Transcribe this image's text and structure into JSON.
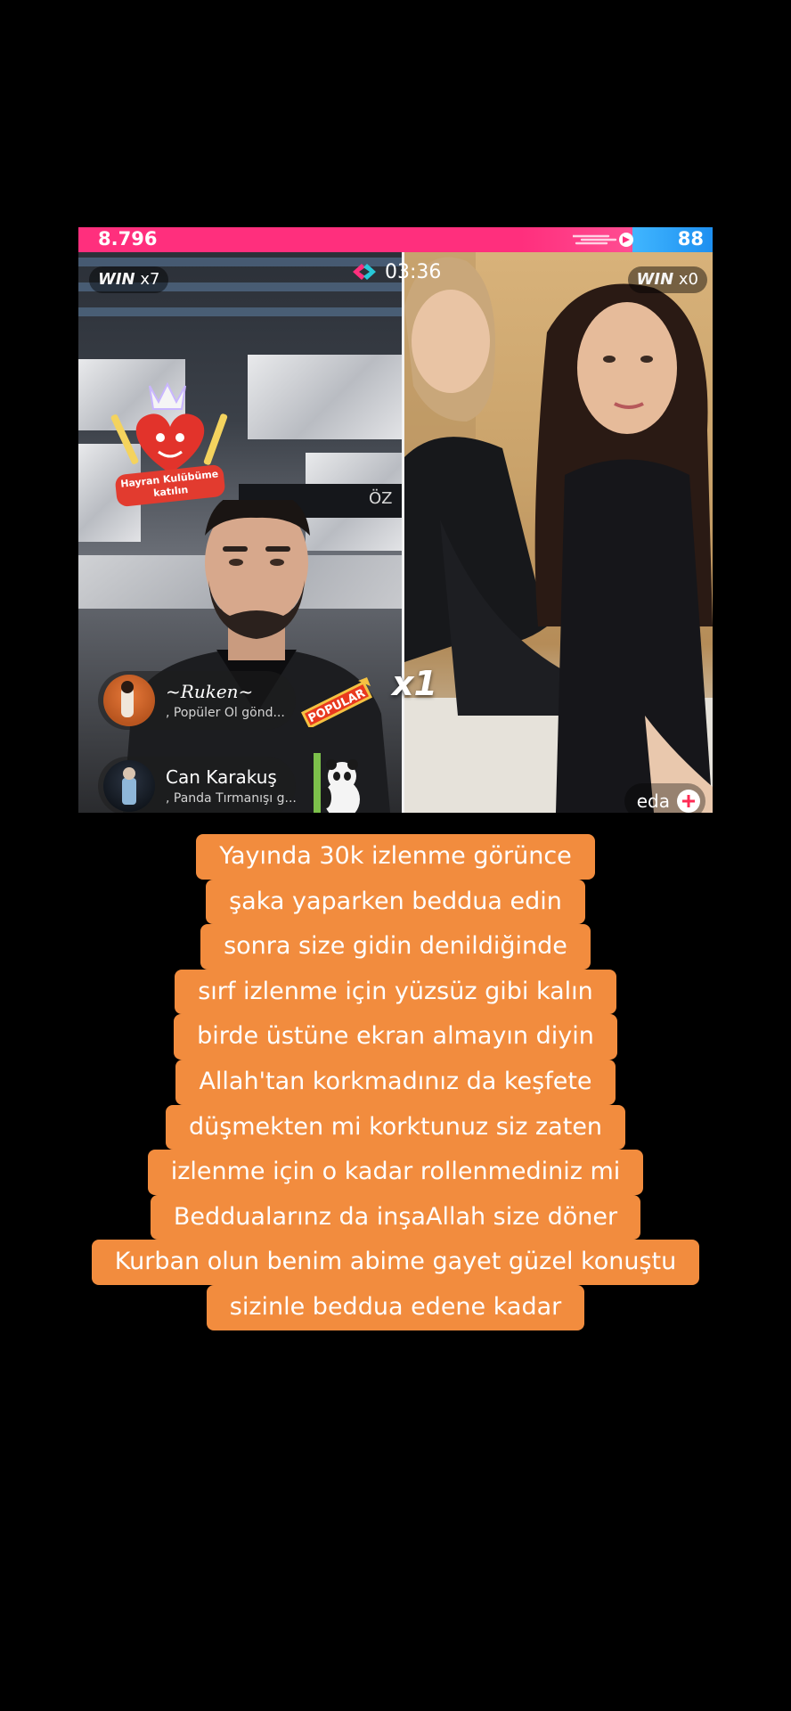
{
  "battle": {
    "score_left": "8.796",
    "score_right": "88",
    "timer": "03:36",
    "win_left": {
      "label": "WIN",
      "count": "x7"
    },
    "win_right": {
      "label": "WIN",
      "count": "x0"
    },
    "fanclub_sticker_text": [
      "Hayran Kulübüme",
      "katılın"
    ],
    "wall_sign_text": "ÖZ",
    "multiplier": "x1",
    "populer_sticker": "POPULAR",
    "viewers": [
      {
        "name": "~Ruken~",
        "subtitle": ", Popüler Ol  gönd..."
      },
      {
        "name": "Can Karakuş",
        "subtitle": ", Panda Tırmanışı g..."
      }
    ],
    "guest_name": "eda",
    "colors": {
      "left_bar": "#ff2f7d",
      "right_bar": "#1e8ff0",
      "caption_bg": "#f28c3e"
    },
    "icons": [
      "battle-icon",
      "crown-icon",
      "heart-icon",
      "add-icon",
      "panda-icon"
    ]
  },
  "caption": {
    "lines": [
      "Yayında 30k izlenme görünce",
      "şaka yaparken beddua edin",
      "sonra size gidin denildiğinde",
      "sırf izlenme için yüzsüz gibi kalın",
      "birde üstüne ekran almayın diyin",
      "Allah'tan korkmadınız da keşfete",
      "düşmekten mi korktunuz siz zaten",
      "izlenme için o kadar rollenmediniz mi",
      "Beddualarınz da inşaAllah size döner",
      "Kurban olun benim abime gayet güzel konuştu",
      "sizinle beddua edene kadar"
    ]
  }
}
